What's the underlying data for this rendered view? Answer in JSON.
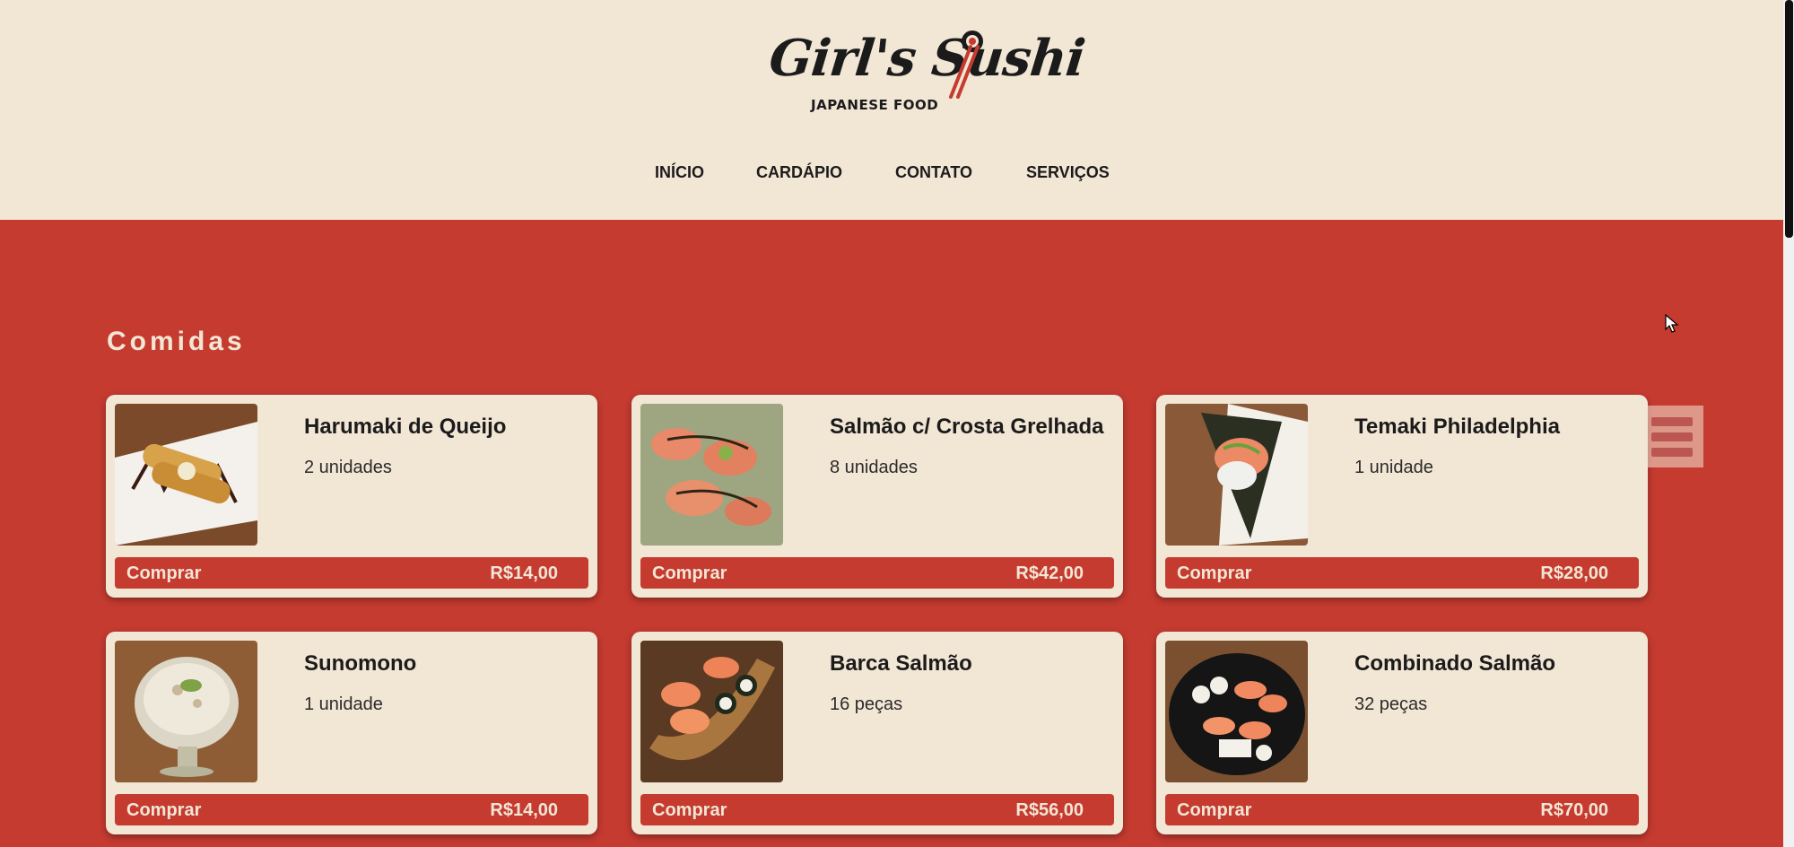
{
  "header": {
    "logo_text": "Girl's Sushi",
    "logo_subtitle": "JAPANESE FOOD",
    "nav": [
      "INÍCIO",
      "CARDÁPIO",
      "CONTATO",
      "SERVIÇOS"
    ]
  },
  "section": {
    "title": "Comidas"
  },
  "buy_label": "Comprar",
  "products": [
    {
      "name": "Harumaki de Queijo",
      "qty": "2 unidades",
      "price": "R$14,00",
      "image": "harumaki-photo"
    },
    {
      "name": "Salmão c/ Crosta Grelhada",
      "qty": "8 unidades",
      "price": "R$42,00",
      "image": "salmon-crust-photo"
    },
    {
      "name": "Temaki Philadelphia",
      "qty": "1 unidade",
      "price": "R$28,00",
      "image": "temaki-photo"
    },
    {
      "name": "Sunomono",
      "qty": "1 unidade",
      "price": "R$14,00",
      "image": "sunomono-photo"
    },
    {
      "name": "Barca Salmão",
      "qty": "16 peças",
      "price": "R$56,00",
      "image": "salmon-boat-photo"
    },
    {
      "name": "Combinado Salmão",
      "qty": "32 peças",
      "price": "R$70,00",
      "image": "salmon-combo-photo"
    }
  ],
  "colors": {
    "cream": "#f2e6d5",
    "red": "#c53b30",
    "text": "#1b1b1b"
  },
  "icons": {
    "menu": "hamburger-menu-icon",
    "logo": "sushi-chopsticks-icon"
  }
}
